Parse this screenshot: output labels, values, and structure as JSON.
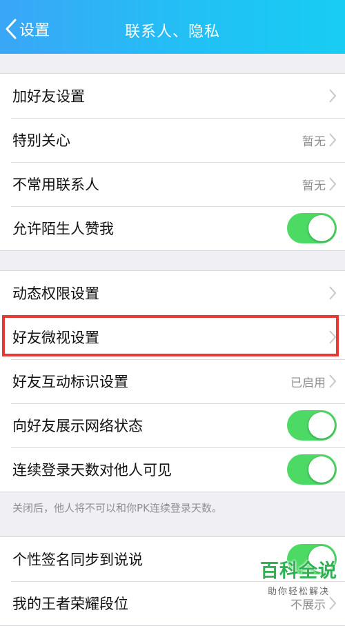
{
  "nav": {
    "back_label": "设置",
    "title": "联系人、隐私"
  },
  "group1": {
    "rows": [
      {
        "label": "加好友设置",
        "value": ""
      },
      {
        "label": "特别关心",
        "value": "暂无"
      },
      {
        "label": "不常用联系人",
        "value": "暂无"
      },
      {
        "label": "允许陌生人赞我",
        "toggle": true
      }
    ]
  },
  "group2": {
    "rows": [
      {
        "label": "动态权限设置",
        "value": ""
      },
      {
        "label": "好友微视设置",
        "value": ""
      },
      {
        "label": "好友互动标识设置",
        "value": "已启用"
      },
      {
        "label": "向好友展示网络状态",
        "toggle": true
      },
      {
        "label": "连续登录天数对他人可见",
        "toggle": true
      }
    ],
    "footnote": "关闭后，他人将不可以和你PK连续登录天数。"
  },
  "group3": {
    "rows": [
      {
        "label": "个性签名同步到说说",
        "toggle": true
      },
      {
        "label": "我的王者荣耀段位",
        "value": "不展示"
      }
    ]
  },
  "watermark": {
    "title": "百科全说",
    "subtitle": "助你轻松解决"
  },
  "colors": {
    "nav_start": "#3aa6f6",
    "nav_end": "#17cdf2",
    "toggle_on": "#4cd964",
    "highlight": "#e53935"
  }
}
